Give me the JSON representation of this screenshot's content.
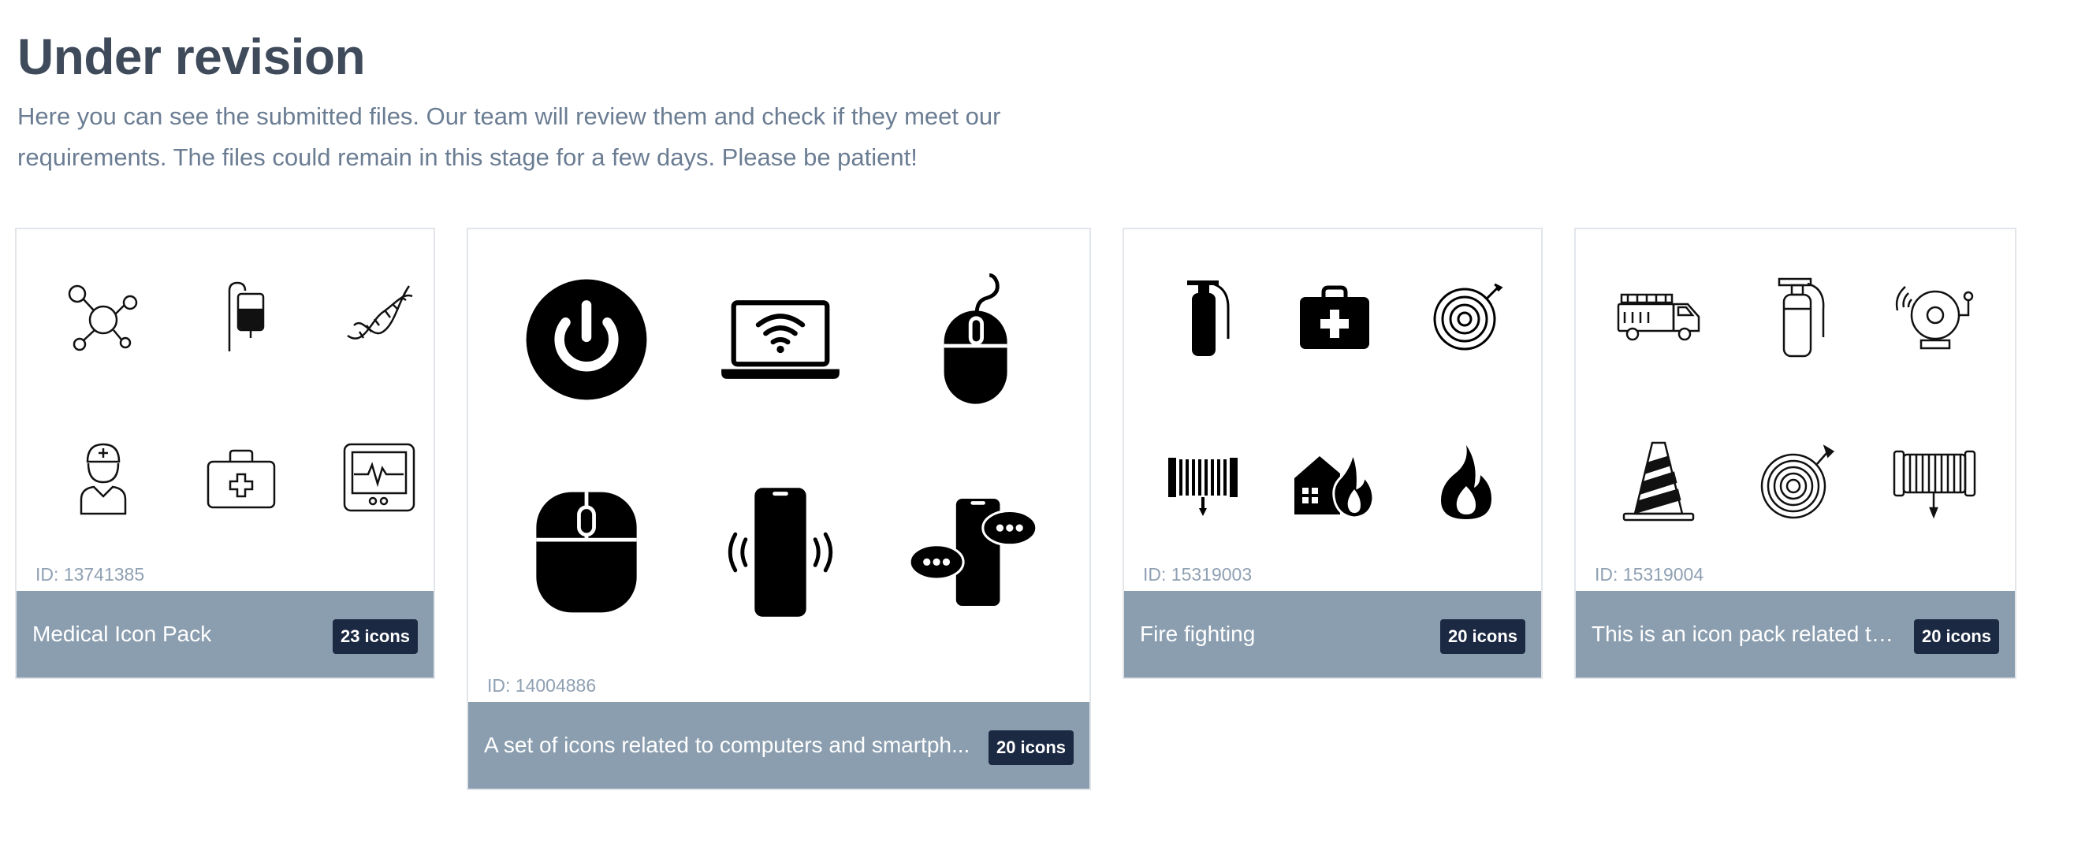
{
  "page": {
    "title": "Under revision",
    "description": "Here you can see the submitted files. Our team will review them and check if they meet our requirements. The files could remain in this stage for a few days. Please be patient!"
  },
  "packs": [
    {
      "id_label": "ID: 13741385",
      "name": "Medical Icon Pack",
      "count_label": "23 icons",
      "icons": [
        "molecule-icon",
        "iv-drip-bag-icon",
        "dna-helix-icon",
        "nurse-icon",
        "first-aid-kit-icon",
        "heart-monitor-icon"
      ]
    },
    {
      "id_label": "ID: 14004886",
      "name": "A set of icons related to computers and smartph...",
      "count_label": "20 icons",
      "icons": [
        "power-button-icon",
        "laptop-wifi-icon",
        "wired-mouse-icon",
        "computer-mouse-icon",
        "vibrating-smartphone-icon",
        "smartphone-chat-icon"
      ]
    },
    {
      "id_label": "ID: 15319003",
      "name": "Fire fighting",
      "count_label": "20 icons",
      "icons": [
        "fire-extinguisher-icon",
        "first-aid-kit-icon",
        "fire-hose-reel-icon",
        "hose-reel-icon",
        "house-fire-icon",
        "flame-icon"
      ]
    },
    {
      "id_label": "ID: 15319004",
      "name": "This is an icon pack related to...",
      "count_label": "20 icons",
      "icons": [
        "fire-truck-icon",
        "fire-extinguisher-icon",
        "fire-alarm-bell-icon",
        "traffic-cone-icon",
        "fire-hose-reel-icon",
        "hose-reel-icon"
      ]
    }
  ]
}
